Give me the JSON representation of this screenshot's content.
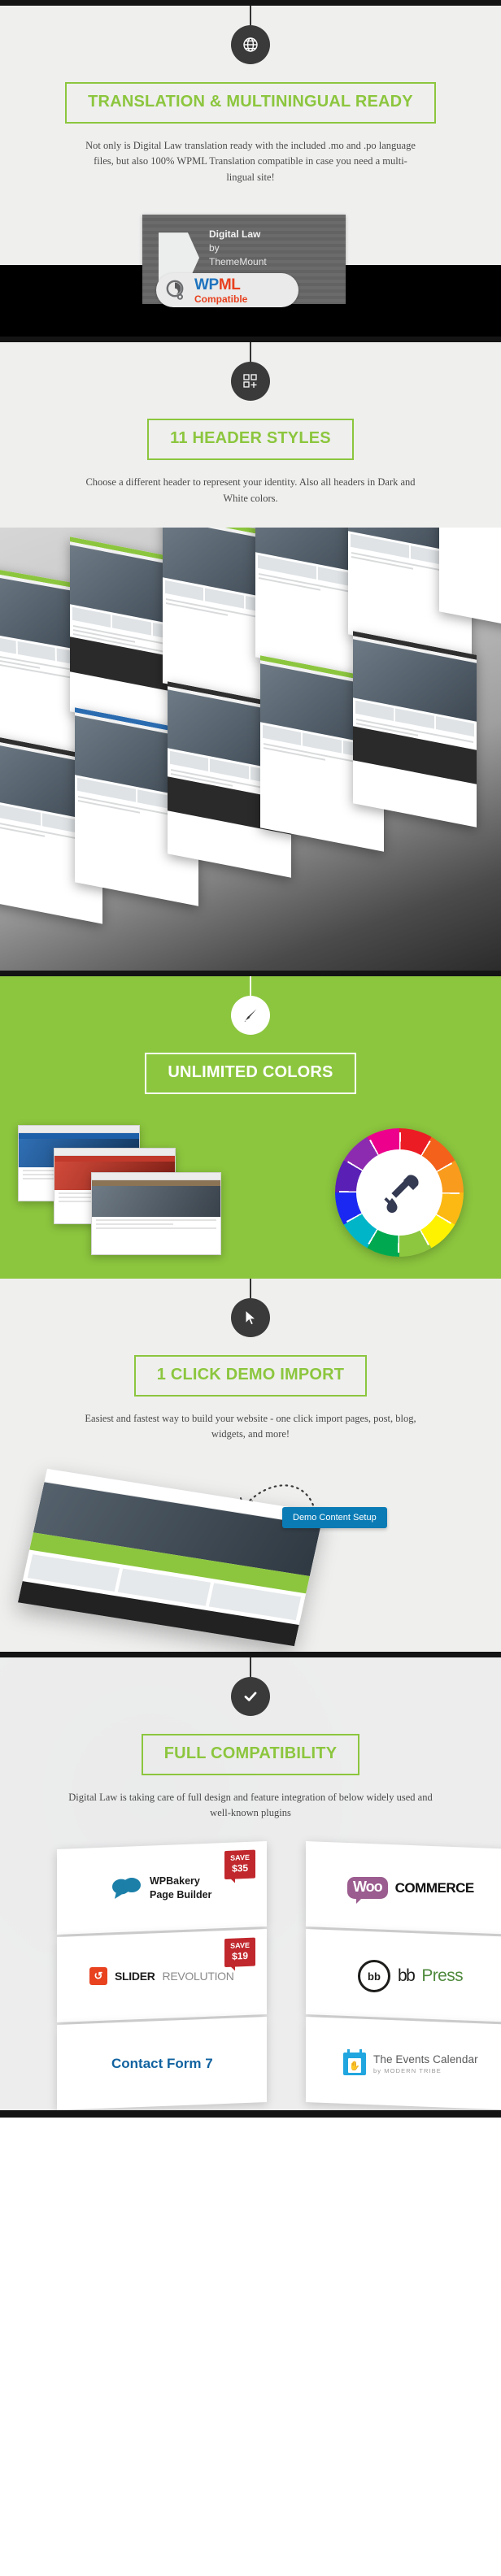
{
  "sections": [
    {
      "id": "translation",
      "icon": "globe-icon",
      "title": "TRANSLATION & MULTININGUAL READY",
      "description": "Not only is Digital Law translation ready with the included .mo and .po language files, but also 100% WPML Translation compatible in case you need a multi-lingual site!",
      "wpml": {
        "theme_name": "Digital Law",
        "by": "by",
        "author": "ThemeMount",
        "logo_wp": "WP",
        "logo_ml": "ML",
        "compatible_label": "Compatible"
      }
    },
    {
      "id": "headers",
      "icon": "grid-plus-icon",
      "title": "11 HEADER STYLES",
      "description": "Choose a different header to represent your identity. Also all headers in Dark and White colors."
    },
    {
      "id": "colors",
      "icon": "paintbrush-icon",
      "title": "UNLIMITED COLORS",
      "description": ""
    },
    {
      "id": "demo",
      "icon": "cursor-arrow-icon",
      "title": "1 CLICK DEMO IMPORT",
      "description": "Easiest and fastest way to build your website - one click import pages, post, blog, widgets, and more!",
      "demo_button_label": "Demo Content Setup"
    },
    {
      "id": "compat",
      "icon": "check-icon",
      "title": "FULL COMPATIBILITY",
      "description": "Digital Law is taking care of full design and feature integration of below widely used and well-known plugins"
    }
  ],
  "plugins": [
    {
      "name": "WPBakery Page Builder",
      "line1": "WPBakery",
      "line2": "Page Builder",
      "save_label": "SAVE",
      "save_amount": "$35",
      "icon": "wpbakery-icon"
    },
    {
      "name": "WooCommerce",
      "line1": "Woo",
      "line2": "COMMERCE",
      "save_label": "",
      "save_amount": "",
      "icon": "woocommerce-icon"
    },
    {
      "name": "Slider Revolution",
      "line1": "SLIDER",
      "line2": "REVOLUTION",
      "save_label": "SAVE",
      "save_amount": "$19",
      "icon": "slider-revolution-icon"
    },
    {
      "name": "bbPress",
      "line1": "bb",
      "line2": "Press",
      "save_label": "",
      "save_amount": "",
      "icon": "bbpress-icon"
    },
    {
      "name": "Contact Form 7",
      "line1": "Contact Form 7",
      "line2": "",
      "save_label": "",
      "save_amount": "",
      "icon": "contact-form-7-icon"
    },
    {
      "name": "The Events Calendar",
      "line1": "The Events Calendar",
      "line2": "by MODERN TRIBE",
      "save_label": "",
      "save_amount": "",
      "icon": "events-calendar-icon"
    }
  ],
  "colors": {
    "accent_green": "#8cc63e",
    "dark": "#3a3a3a",
    "light_bg": "#efefee",
    "blue_button": "#0a7bb5",
    "save_red": "#c0282d",
    "wpml_blue": "#1e73be",
    "wpml_red": "#e8401f"
  },
  "color_wheel": {
    "swatches": [
      "#ec1c24",
      "#f4611a",
      "#f99b1c",
      "#fcb913",
      "#fff200",
      "#8dc63f",
      "#00a94f",
      "#00b5c7",
      "#1b28f2",
      "#5a1fb5",
      "#8d2bb0",
      "#ec008c"
    ]
  }
}
